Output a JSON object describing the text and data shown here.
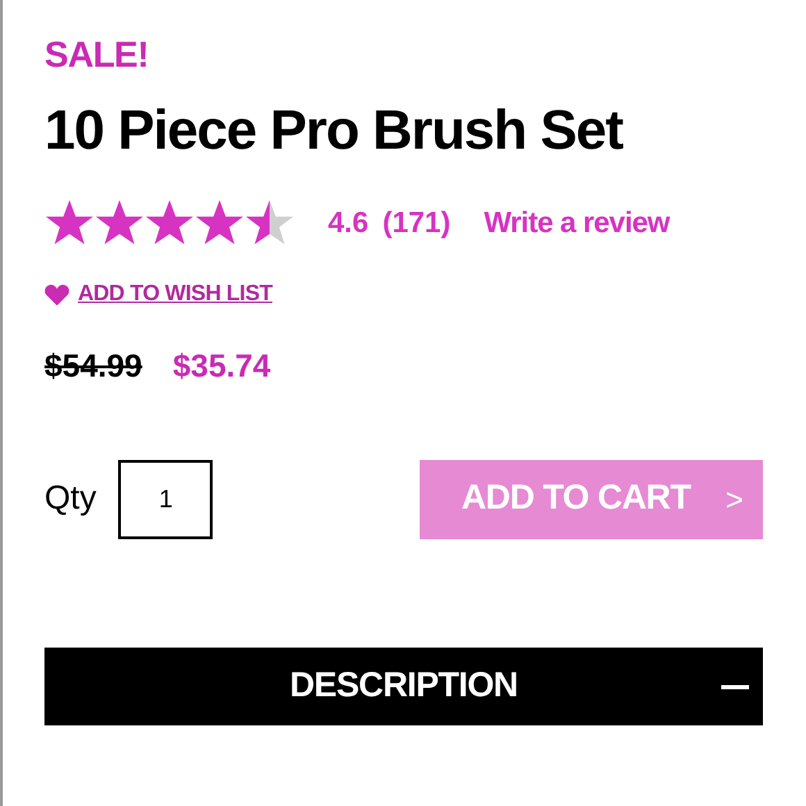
{
  "sale_label": "SALE!",
  "product": {
    "title": "10 Piece Pro Brush Set"
  },
  "rating": {
    "stars": 4.5,
    "score": "4.6",
    "count": "(171)",
    "review_link": "Write a review"
  },
  "wish_list": {
    "label": "ADD TO WISH LIST"
  },
  "price": {
    "original": "$54.99",
    "sale": "$35.74"
  },
  "quantity": {
    "label": "Qty",
    "value": "1"
  },
  "add_to_cart": {
    "label": "ADD TO CART",
    "arrow": ">"
  },
  "description": {
    "title": "DESCRIPTION",
    "expanded": true
  }
}
